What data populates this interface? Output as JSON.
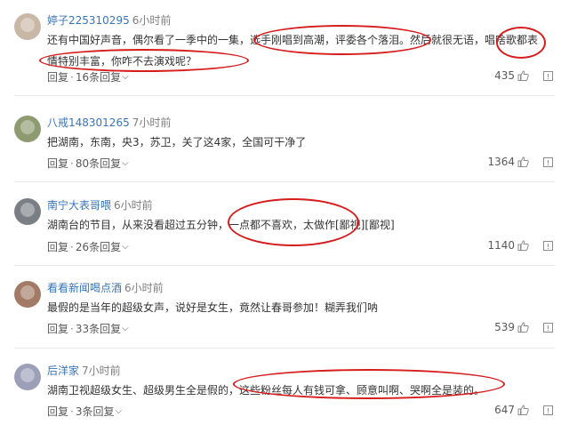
{
  "comments": [
    {
      "username": "婷子225310295",
      "time": "6小时前",
      "text": "还有中国好声音，偶尔看了一季中的一集，选手刚唱到高潮，评委各个落泪。然后就很无语，唱啥歌都表情特别丰富，你咋不去演戏呢？",
      "reply": "回复",
      "replies": "16条回复",
      "likes": "435",
      "avatar_color": "#c9b7a6"
    },
    {
      "username": "八戒148301265",
      "time": "7小时前",
      "text": "把湖南，东南，央3，苏卫，关了这4家，全国可干净了",
      "reply": "回复",
      "replies": "80条回复",
      "likes": "1364",
      "avatar_color": "#8e9a6f"
    },
    {
      "username": "南宁大表哥喂",
      "time": "6小时前",
      "text": "湖南台的节目，从来没看超过五分钟，一点都不喜欢，太做作[鄙视][鄙视]",
      "reply": "回复",
      "replies": "26条回复",
      "likes": "1140",
      "avatar_color": "#7a7f86"
    },
    {
      "username": "看看新闻喝点酒",
      "time": "6小时前",
      "text": "最假的是当年的超级女声，说好是女生，竟然让春哥参加！糊弄我们呐",
      "reply": "回复",
      "replies": "33条回复",
      "likes": "539",
      "avatar_color": "#a27a66"
    },
    {
      "username": "后洋家",
      "time": "7小时前",
      "text": "湖南卫视超级女生、超级男生全是假的，这些粉丝每人有钱可拿、顾意叫啊、哭啊全是装的。",
      "reply": "回复",
      "replies": "3条回复",
      "likes": "647",
      "avatar_color": "#9c9fb8"
    }
  ],
  "colors": {
    "username": "#3a74b8",
    "annotation": "#d61c1c"
  },
  "icons": {
    "like": "thumbs-up-icon",
    "report": "report-icon",
    "expand": "chevron-down-icon"
  }
}
